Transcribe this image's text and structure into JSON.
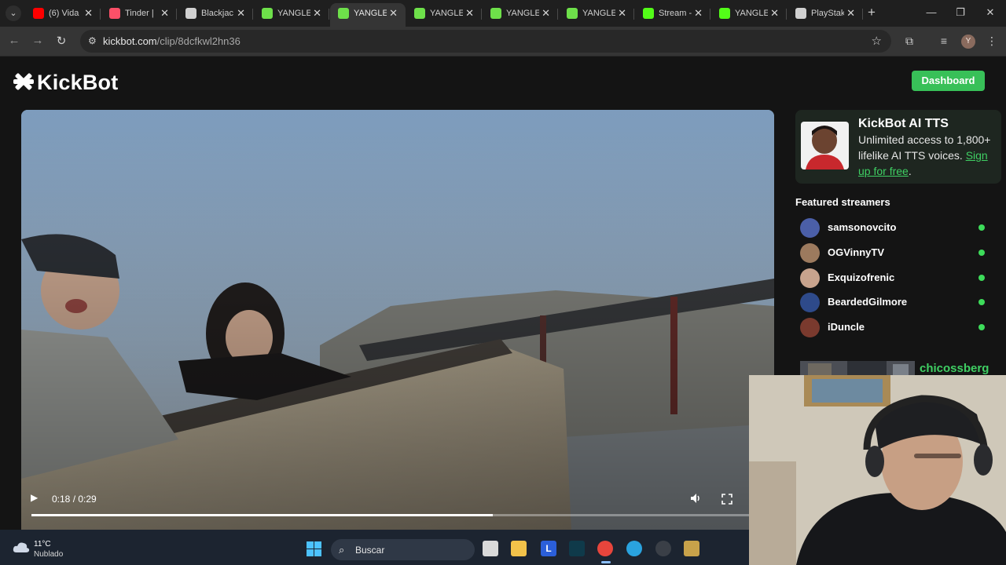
{
  "browser": {
    "tabs": [
      {
        "title": "(6) Vida",
        "favicon": "youtube-icon",
        "color": "#ff0000"
      },
      {
        "title": "Tinder |",
        "favicon": "tinder-flame-icon",
        "color": "#fd5068"
      },
      {
        "title": "Blackjac",
        "favicon": "stake-s-icon",
        "color": "#d0d0d0"
      },
      {
        "title": "YANGLE",
        "favicon": "kickbot-icon",
        "color": "#6ee04a"
      },
      {
        "title": "YANGLE",
        "favicon": "kickbot-icon",
        "color": "#6ee04a",
        "active": true
      },
      {
        "title": "YANGLE",
        "favicon": "kickbot-icon",
        "color": "#6ee04a"
      },
      {
        "title": "YANGLE",
        "favicon": "kickbot-icon",
        "color": "#6ee04a"
      },
      {
        "title": "YANGLE",
        "favicon": "kickbot-icon",
        "color": "#6ee04a"
      },
      {
        "title": "Stream -",
        "favicon": "kick-k-icon",
        "color": "#53fc18"
      },
      {
        "title": "YANGLE",
        "favicon": "kick-k-icon",
        "color": "#53fc18"
      },
      {
        "title": "PlayStak",
        "favicon": "stake-s-icon",
        "color": "#d0d0d0"
      }
    ],
    "url_domain": "kickbot.com",
    "url_path": "/clip/8dcfkwl2hn36",
    "profile_initial": "Y"
  },
  "header": {
    "logo_text": "KickBot",
    "dashboard_label": "Dashboard",
    "accent": "#38c058"
  },
  "video": {
    "time_label": "0:18 / 0:29",
    "progress_fraction": 0.63
  },
  "promo": {
    "title": "KickBot AI TTS",
    "text": "Unlimited access to 1,800+ lifelike AI TTS voices.",
    "link_text": "Sign up for free",
    "after_link": "."
  },
  "featured": {
    "title": "Featured streamers",
    "streamers": [
      {
        "name": "samsonovcito",
        "online": true
      },
      {
        "name": "OGVinnyTV",
        "online": true
      },
      {
        "name": "Exquizofrenic",
        "online": true
      },
      {
        "name": "BeardedGilmore",
        "online": true
      },
      {
        "name": "iDuncle",
        "online": true
      }
    ],
    "clip_streamer": "chicossberg",
    "online_color": "#3ddc5a"
  },
  "taskbar": {
    "temperature": "11°C",
    "condition": "Nublado",
    "search_label": "Buscar"
  }
}
